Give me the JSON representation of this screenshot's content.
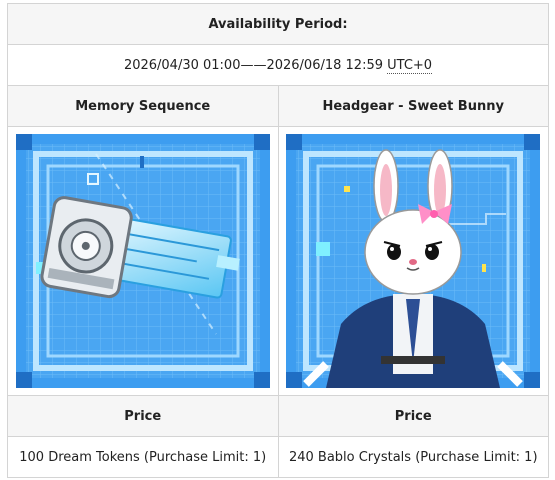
{
  "period": {
    "header": "Availability Period:",
    "range": "2026/04/30 01:00——2026/06/18 12:59 ",
    "tz": "UTC+0"
  },
  "items": [
    {
      "name": "Memory Sequence",
      "image": "memory-sequence-chip-icon",
      "price_label": "Price",
      "price": "100 Dream Tokens (Purchase Limit: 1)"
    },
    {
      "name": "Headgear - Sweet Bunny",
      "image": "bunny-headgear-character-icon",
      "price_label": "Price",
      "price": "240 Bablo Crystals (Purchase Limit: 1)"
    }
  ],
  "colors": {
    "frame_blue": "#3d9df0",
    "grid_blue": "#67b8f7",
    "border": "#d4d4d4"
  }
}
